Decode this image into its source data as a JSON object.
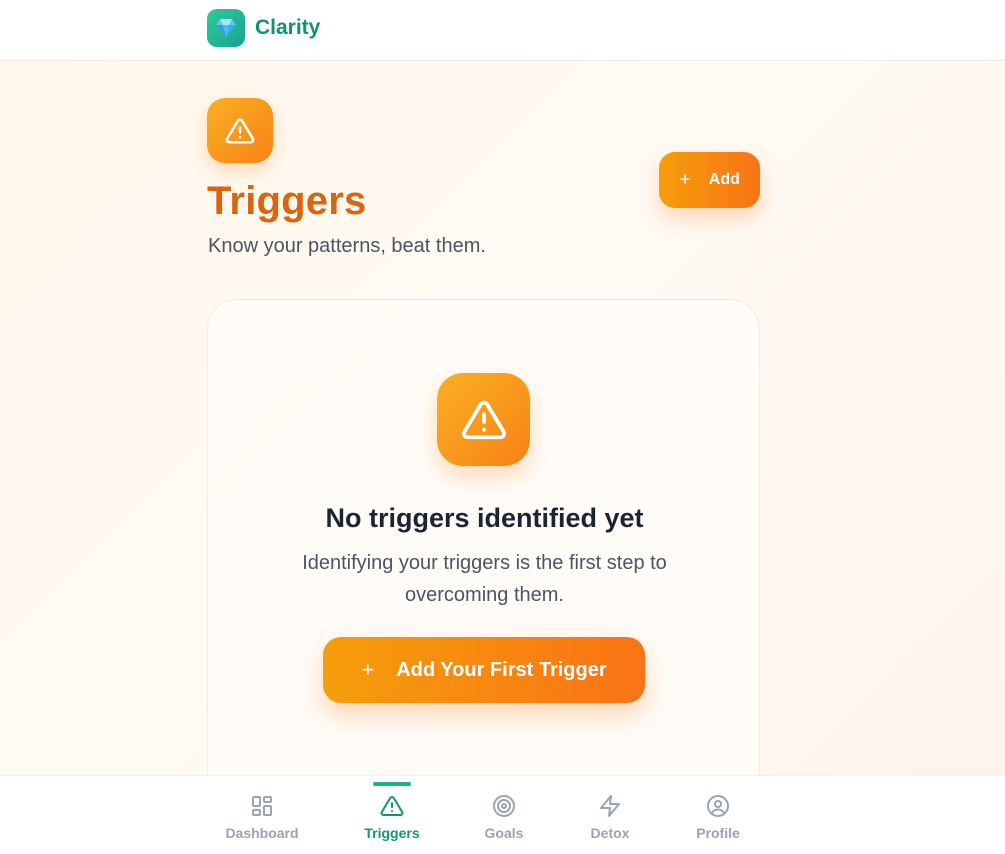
{
  "brand": {
    "name": "Clarity",
    "logo_icon": "gem-icon"
  },
  "page": {
    "title": "Triggers",
    "subtitle": "Know your patterns, beat them.",
    "icon": "alert-triangle-icon",
    "add_label": "Add"
  },
  "empty_state": {
    "title": "No triggers identified yet",
    "description": "Identifying your triggers is the first step to overcoming them.",
    "button_label": "Add Your First Trigger"
  },
  "nav": {
    "items": [
      {
        "label": "Dashboard",
        "icon": "grid-icon",
        "active": false
      },
      {
        "label": "Triggers",
        "icon": "alert-triangle-icon",
        "active": true
      },
      {
        "label": "Goals",
        "icon": "target-icon",
        "active": false
      },
      {
        "label": "Detox",
        "icon": "lightning-icon",
        "active": false
      },
      {
        "label": "Profile",
        "icon": "user-circle-icon",
        "active": false
      }
    ]
  },
  "colors": {
    "brand": "#119275",
    "accent_orange": "#f97316",
    "accent_amber": "#f59e0b",
    "title_orange": "#d9650e",
    "nav_active": "#15956f",
    "nav_inactive": "#9aa3b2"
  }
}
